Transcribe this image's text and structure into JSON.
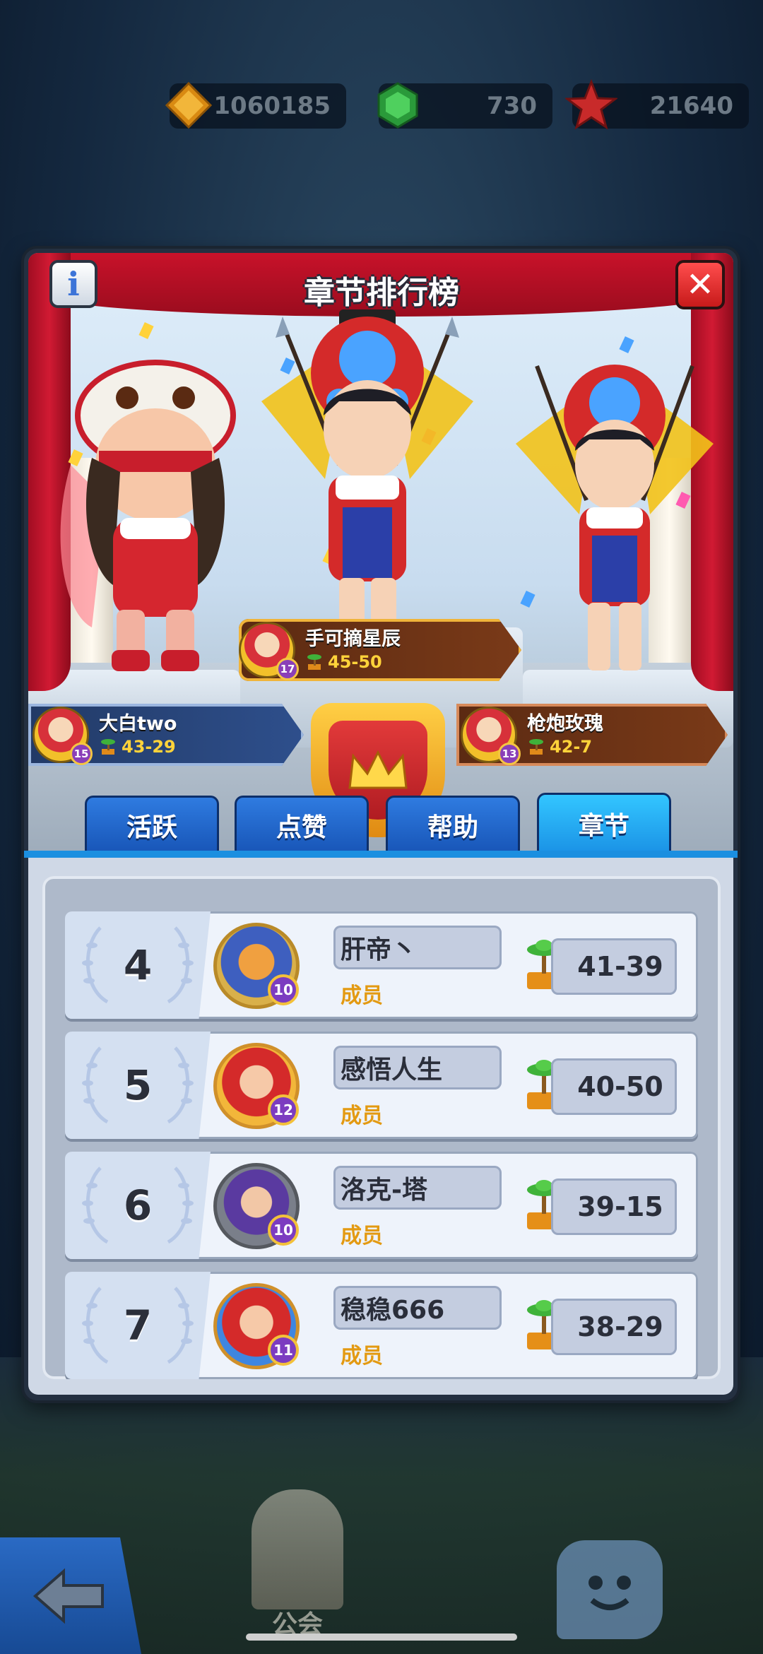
{
  "currencies": [
    {
      "icon": "gold-diamond-icon",
      "value": "1060185",
      "color": "#f0a318"
    },
    {
      "icon": "green-gem-icon",
      "value": "730",
      "color": "#38c24a"
    },
    {
      "icon": "red-star-icon",
      "value": "21640",
      "color": "#e23434"
    }
  ],
  "dialog": {
    "title": "章节排行榜",
    "info_label": "i",
    "close_label": "✕"
  },
  "podium": {
    "first": {
      "name": "手可摘星辰",
      "level": "17",
      "score": "45-50"
    },
    "second": {
      "name": "大白two",
      "level": "15",
      "score": "43-29"
    },
    "third": {
      "name": "枪炮玫瑰",
      "level": "13",
      "score": "42-7"
    }
  },
  "tabs": [
    {
      "label": "活跃",
      "active": false
    },
    {
      "label": "点赞",
      "active": false
    },
    {
      "label": "帮助",
      "active": false
    },
    {
      "label": "章节",
      "active": true
    }
  ],
  "rows": [
    {
      "rank": "4",
      "name": "肝帝丶",
      "role": "成员",
      "level": "10",
      "score": "41-39"
    },
    {
      "rank": "5",
      "name": "感悟人生",
      "role": "成员",
      "level": "12",
      "score": "40-50"
    },
    {
      "rank": "6",
      "name": "洛克-塔",
      "role": "成员",
      "level": "10",
      "score": "39-15"
    },
    {
      "rank": "7",
      "name": "稳稳666",
      "role": "成员",
      "level": "11",
      "score": "38-29"
    }
  ],
  "bottom": {
    "guild_label": "公会",
    "back_icon": "back-arrow-icon",
    "chat_icon": "chat-icon"
  }
}
